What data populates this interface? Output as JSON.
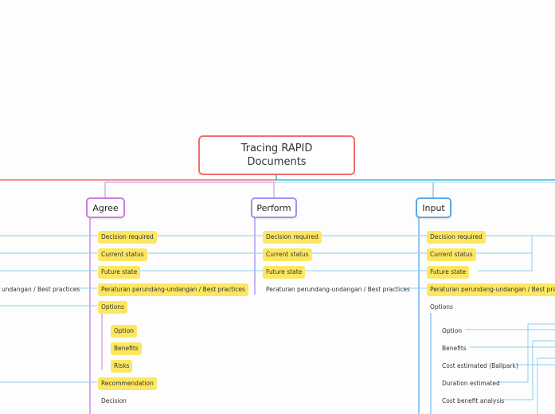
{
  "root": {
    "title_line1": "Tracing RAPID",
    "title_line2": "Documents"
  },
  "colors": {
    "root": "#f26d6d",
    "agree": "#c77ee0",
    "perform": "#a88ef0",
    "input": "#5aaae8",
    "link": "#8ccff0",
    "highlight": "#fde761"
  },
  "branches": {
    "agree": {
      "label": "Agree",
      "items": [
        "Decision required",
        "Current status",
        "Future state",
        "Peraturan perundang-undangan / Best practices",
        "Options"
      ],
      "options_children": [
        "Option",
        "Benefits",
        "Risks"
      ],
      "after": [
        "Recommendation",
        "Decision"
      ]
    },
    "perform": {
      "label": "Perform",
      "items": [
        "Decision required",
        "Current status",
        "Future state",
        "Peraturan perundang-undangan / Best practices"
      ]
    },
    "input": {
      "label": "Input",
      "items": [
        "Decision required",
        "Current status",
        "Future state",
        "Peraturan perundang-undangan / Best practices",
        "Options"
      ],
      "options_children": [
        "Option",
        "Benefits",
        "Cost estimated (Ballpark)",
        "Duration estimated",
        "Cost benefit analysis"
      ]
    },
    "left_partial": {
      "label": "undangan / Best practices"
    }
  }
}
